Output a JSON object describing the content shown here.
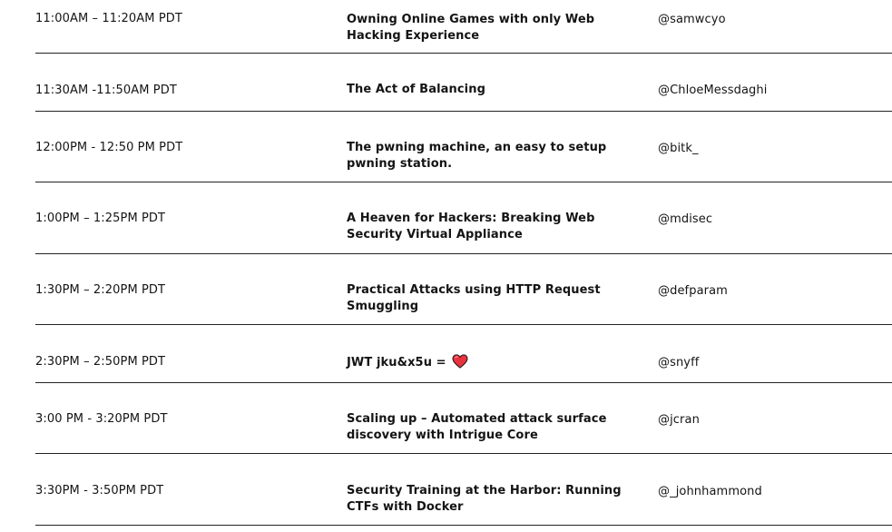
{
  "schedule": {
    "rows": [
      {
        "time": "11:00AM – 11:20AM PDT",
        "title_lines": [
          "Owning Online Games with only Web",
          "Hacking Experience"
        ],
        "speaker": "@samwcyo"
      },
      {
        "time": "11:30AM -11:50AM PDT",
        "title_lines": [
          "The Act of Balancing"
        ],
        "speaker": "@ChloeMessdaghi"
      },
      {
        "time": "12:00PM - 12:50 PM PDT",
        "title_lines": [
          "The pwning machine, an easy to setup",
          "pwning station."
        ],
        "speaker": "@bitk_"
      },
      {
        "time": "1:00PM – 1:25PM PDT",
        "title_lines": [
          "A Heaven for Hackers: Breaking Web",
          "Security Virtual Appliance"
        ],
        "speaker": "@mdisec"
      },
      {
        "time": "1:30PM – 2:20PM PDT",
        "title_lines": [
          "Practical Attacks using HTTP Request",
          "Smuggling"
        ],
        "speaker": "@defparam"
      },
      {
        "time": "2:30PM – 2:50PM PDT",
        "title_lines": [
          "JWT jku&x5u ="
        ],
        "title_icon": "red-heart-icon",
        "heart_color": "#e8323e",
        "speaker": "@snyff"
      },
      {
        "time": "3:00 PM - 3:20PM PDT",
        "title_lines": [
          "Scaling up – Automated attack surface",
          "discovery with Intrigue Core"
        ],
        "speaker": "@jcran"
      },
      {
        "time": "3:30PM - 3:50PM PDT",
        "title_lines": [
          "Security Training at the Harbor: Running",
          "CTFs with Docker"
        ],
        "speaker": "@_johnhammond"
      }
    ]
  },
  "colors": {
    "text": "#141414",
    "divider": "#222222",
    "heart": "#e8323e"
  }
}
